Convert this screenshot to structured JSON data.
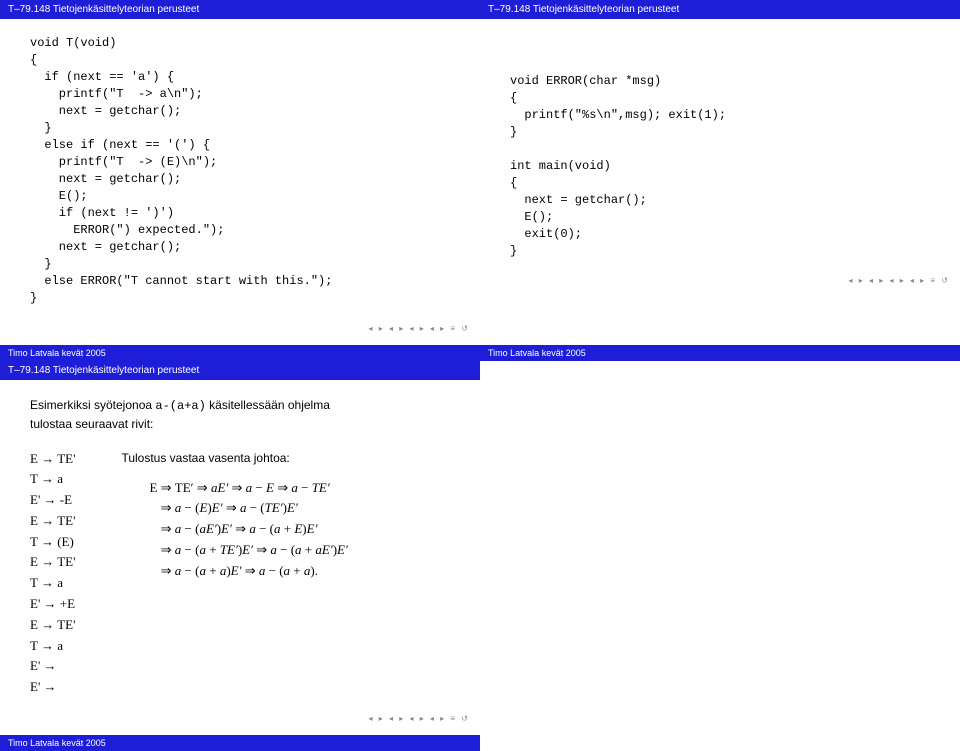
{
  "header": "T–79.148 Tietojenkäsittelyteorian perusteet",
  "footer": "Timo Latvala kevät 2005",
  "nav": "◂ ▸ ◂ ▸ ◂ ▸ ◂ ▸ ≡ ↺",
  "slide1_code": "void T(void)\n{\n  if (next == 'a') {\n    printf(\"T  -> a\\n\");\n    next = getchar();\n  }\n  else if (next == '(') {\n    printf(\"T  -> (E)\\n\");\n    next = getchar();\n    E();\n    if (next != ')')\n      ERROR(\") expected.\");\n    next = getchar();\n  }\n  else ERROR(\"T cannot start with this.\");\n}",
  "slide2_code": "void ERROR(char *msg)\n{\n  printf(\"%s\\n\",msg); exit(1);\n}\n\nint main(void)\n{\n  next = getchar();\n  E();\n  exit(0);\n}",
  "slide3": {
    "intro1": "Esimerkiksi syötejonoa ",
    "intro_code": "a-(a+a)",
    "intro2": " käsitellessään ohjelma",
    "intro3": "tulostaa seuraavat rivit:",
    "left_derivation": "E → TE'\nT → a\nE' → -E\nE → TE'\nT → (E)\nE → TE'\nT → a\nE' → +E\nE → TE'\nT → a\nE' →\nE' →",
    "right_title": "Tulostus vastaa vasenta johtoa:",
    "right_lines": [
      "E  ⇒  TE' ⇒ aE' ⇒ a − E ⇒ a − TE'",
      "    ⇒  a − (E)E' ⇒ a − (TE')E'",
      "    ⇒  a − (aE')E' ⇒ a − (a + E)E'",
      "    ⇒  a − (a + TE')E' ⇒ a − (a + aE')E'",
      "    ⇒  a − (a + a)E' ⇒ a − (a + a)."
    ]
  }
}
